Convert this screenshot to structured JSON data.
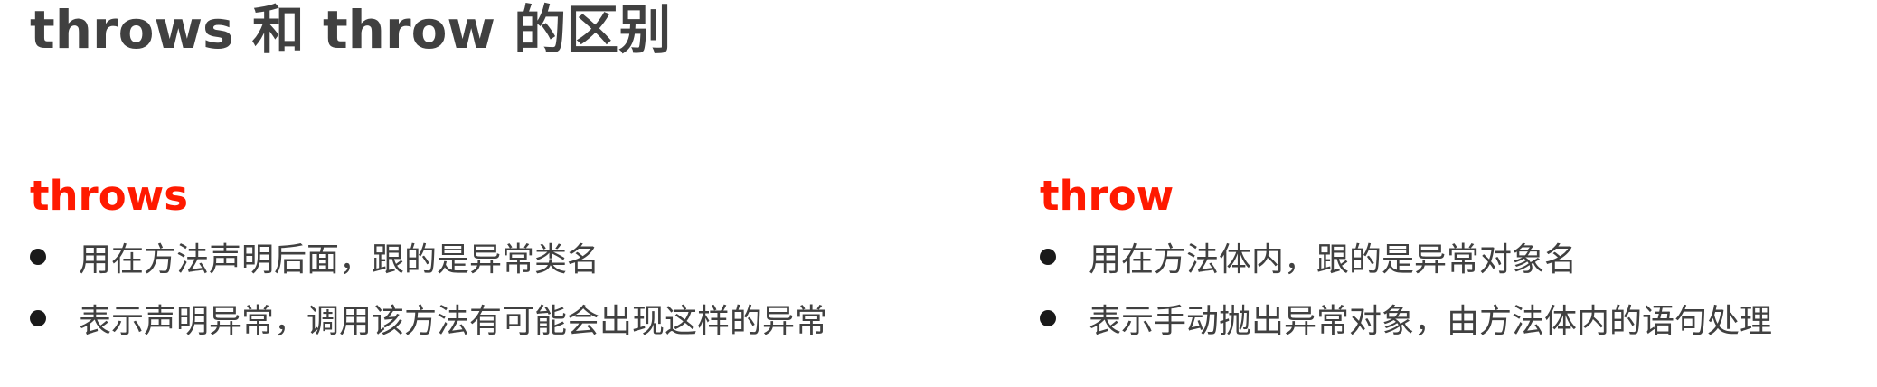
{
  "title": "throws 和 throw 的区别",
  "sections": [
    {
      "heading": "throws",
      "items": [
        "用在方法声明后面，跟的是异常类名",
        "表示声明异常，调用该方法有可能会出现这样的异常"
      ]
    },
    {
      "heading": "throw",
      "items": [
        "用在方法体内，跟的是异常对象名",
        "表示手动抛出异常对象，由方法体内的语句处理"
      ]
    }
  ],
  "colors": {
    "title": "#404040",
    "heading_accent": "#ff1a00",
    "body_text": "#404040",
    "bullet": "#1a1a1a"
  }
}
